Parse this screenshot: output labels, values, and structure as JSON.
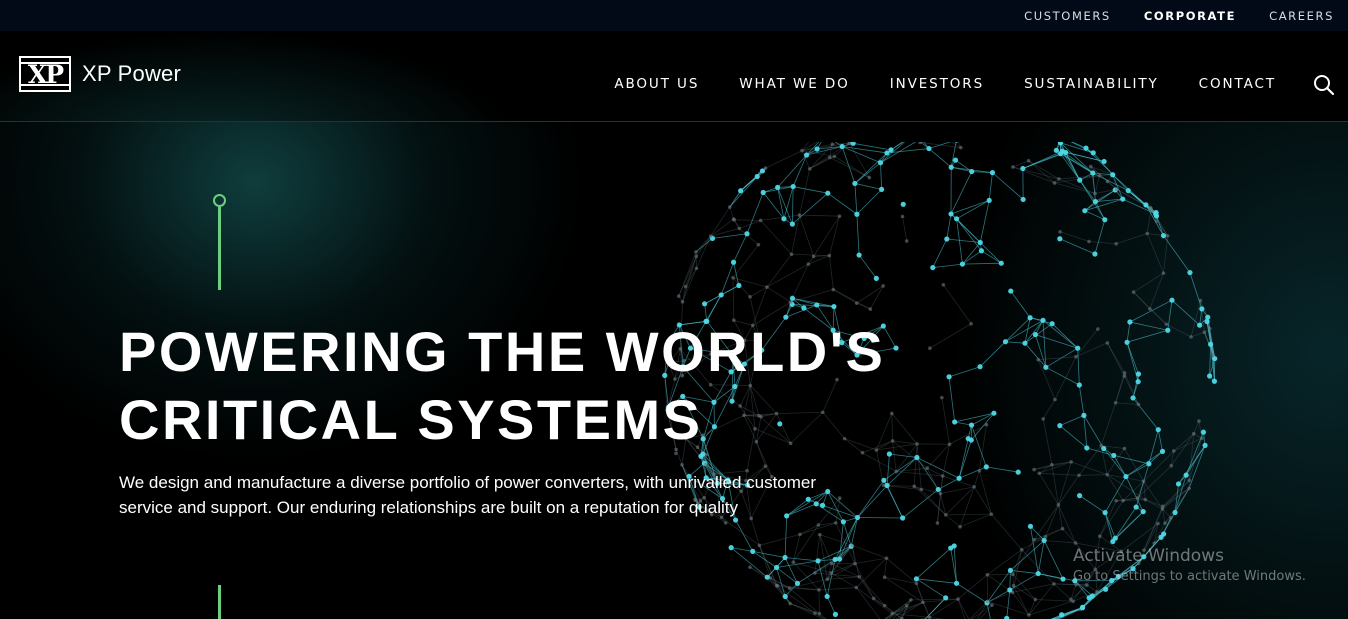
{
  "topbar": {
    "links": [
      {
        "label": "CUSTOMERS"
      },
      {
        "label": "CORPORATE"
      },
      {
        "label": "CAREERS"
      }
    ]
  },
  "header": {
    "logo_mark": "XP",
    "logo_text": "XP Power",
    "nav": [
      {
        "label": "ABOUT US"
      },
      {
        "label": "WHAT WE DO"
      },
      {
        "label": "INVESTORS"
      },
      {
        "label": "SUSTAINABILITY"
      },
      {
        "label": "CONTACT"
      }
    ],
    "search_icon": "search-icon"
  },
  "hero": {
    "headline_line1": "POWERING THE WORLD'S",
    "headline_line2": "CRITICAL SYSTEMS",
    "description": "We design and manufacture a diverse portfolio of power converters, with unrivalled customer service and support. Our enduring relationships are built on a reputation for quality",
    "accent_color": "#6ad07e",
    "globe_color": "#4fd8e6"
  },
  "watermark": {
    "title": "Activate Windows",
    "subtitle": "Go to Settings to activate Windows."
  }
}
